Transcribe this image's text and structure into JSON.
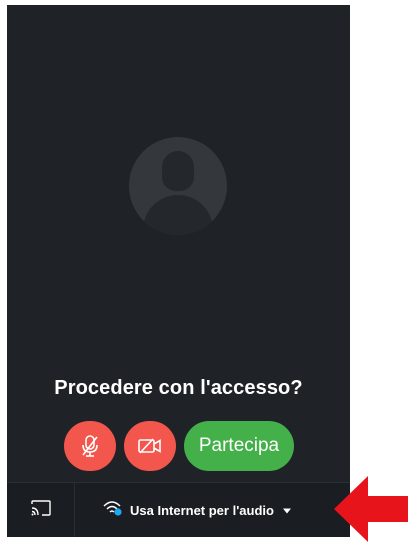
{
  "prompt": {
    "title": "Procedere con l'accesso?"
  },
  "controls": {
    "mute_icon": "microphone-off-icon",
    "video_icon": "video-off-icon",
    "join_label": "Partecipa"
  },
  "toolbar": {
    "cast_icon": "cast-icon",
    "audio_icon": "wifi-audio-icon",
    "audio_label": "Usa Internet per l'audio",
    "dropdown_icon": "caret-down-icon"
  },
  "colors": {
    "background": "#1f2226",
    "red_button": "#f2564d",
    "green_button": "#44b04a",
    "annotation_arrow": "#e8141b"
  }
}
